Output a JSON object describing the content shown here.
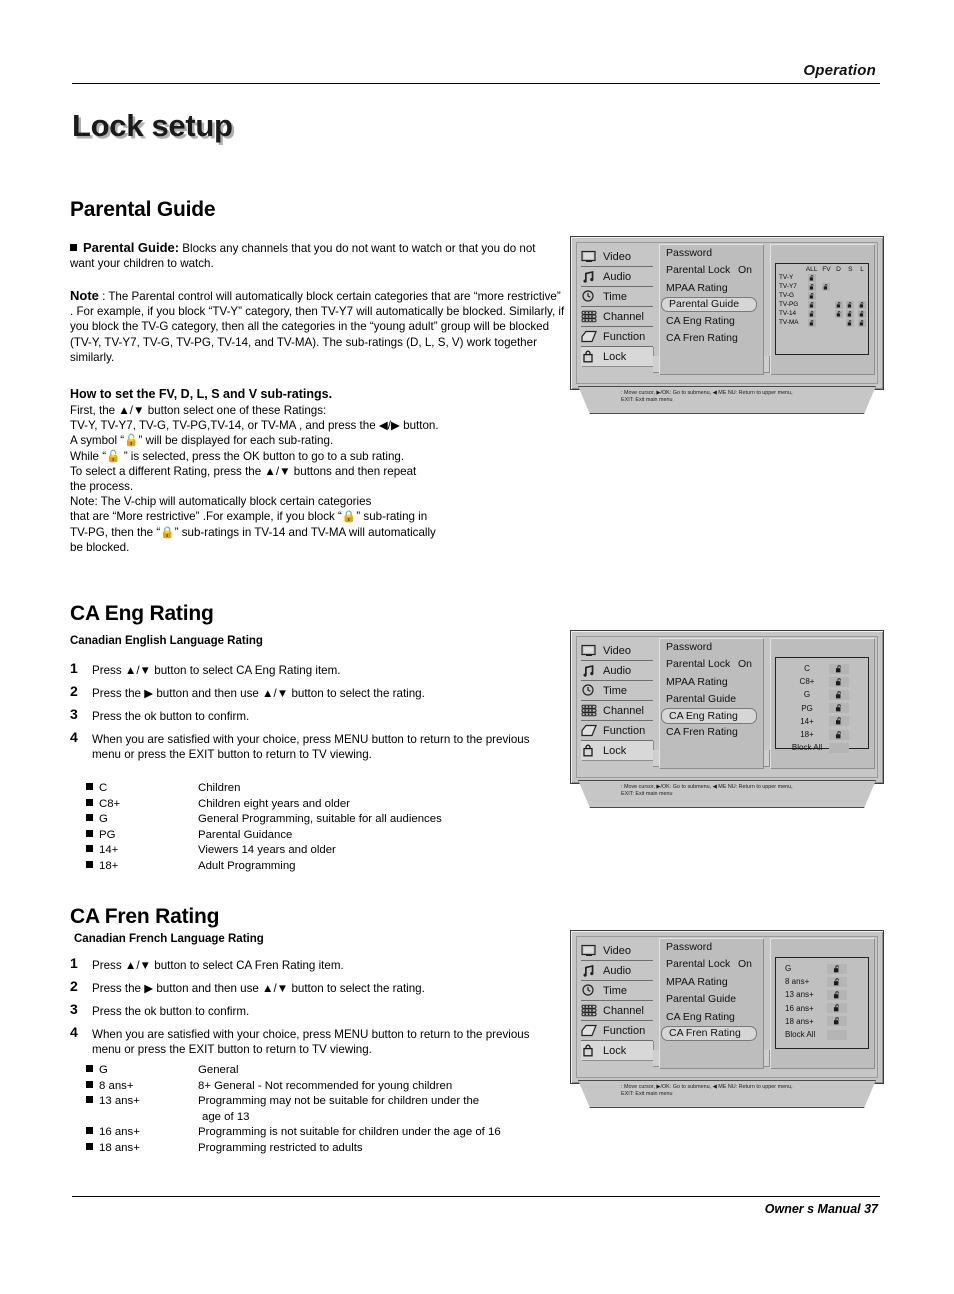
{
  "header": {
    "section_label": "Operation"
  },
  "footer": {
    "label": "Owner s Manual  37"
  },
  "page_title": "Lock setup",
  "sections": {
    "parental_guide": {
      "heading": "Parental Guide",
      "bullet_term": "Parental Guide:",
      "bullet_text": " Blocks any channels that you do not want to watch or that you do not want your children to watch.",
      "note_term": "Note",
      "note_text": " : The Parental control will automatically block certain categories that are  “more restrictive” . For example, if you block  “TV-Y”  category, then TV-Y7 will automatically be blocked. Similarly, if you block the TV-G category, then all the categories in the  “young adult”  group will be blocked (TV-Y, TV-Y7, TV-G, TV-PG, TV-14, and TV-MA). The sub-ratings (D, L, S, V) work together similarly.",
      "how_heading": "How to set the FV, D, L, S and V sub-ratings.",
      "how_lines": [
        "First, the ▲/▼ button select one of these Ratings:",
        "TV-Y, TV-Y7, TV-G, TV-PG,TV-14, or TV-MA , and press the ◀/▶ button.",
        "A symbol  “🔓”  will be displayed for each sub-rating.",
        "While “🔓 ”  is selected, press the OK button to go to a sub rating.",
        " To select a different Rating, press the ▲/▼ buttons and then repeat",
        "the process.",
        "Note: The V-chip will automatically block certain categories",
        "that are  “More restrictive”  .For example, if you block  “🔒”  sub-rating in",
        "TV-PG, then the  “🔒”  sub-ratings in TV-14 and TV-MA will automatically",
        "be blocked."
      ]
    },
    "ca_eng": {
      "heading": "CA Eng Rating",
      "subheading": "Canadian English Language Rating",
      "steps": [
        {
          "num": "1",
          "text": "Press ▲/▼ button to select CA Eng Rating item."
        },
        {
          "num": "2",
          "text": "Press the ▶ button and then use ▲/▼ button to select the rating."
        },
        {
          "num": "3",
          "text": "Press the ok button to confirm."
        },
        {
          "num": "4",
          "text": "When you are satisfied with your choice,  press MENU button to return to the previous menu or press the EXIT button to return to TV viewing."
        }
      ],
      "definitions": [
        {
          "term": "C",
          "desc": "Children"
        },
        {
          "term": "C8+",
          "desc": "Children eight years and older"
        },
        {
          "term": "G",
          "desc": "General Programming, suitable for all audiences"
        },
        {
          "term": "PG",
          "desc": "Parental Guidance"
        },
        {
          "term": "14+",
          "desc": "Viewers 14 years and older"
        },
        {
          "term": "18+",
          "desc": "Adult Programming"
        }
      ]
    },
    "ca_fren": {
      "heading": "CA Fren Rating",
      "subheading": "Canadian French Language Rating",
      "steps": [
        {
          "num": "1",
          "text": "Press ▲/▼ button to select CA Fren Rating item."
        },
        {
          "num": "2",
          "text": "Press the ▶ button and then use ▲/▼ button to select the rating."
        },
        {
          "num": "3",
          "text": "Press the ok button to confirm."
        },
        {
          "num": "4",
          "text": "When you are satisfied with your choice,  press MENU button to return to the previous menu or press the EXIT button to return to TV viewing."
        }
      ],
      "definitions": [
        {
          "term": "G",
          "desc": "General"
        },
        {
          "term": "8 ans+",
          "desc": "8+ General - Not recommended for young children"
        },
        {
          "term": "13 ans+",
          "desc": "Programming may not be suitable for children under the"
        },
        {
          "term": "",
          "desc": "age of 13"
        },
        {
          "term": "16 ans+",
          "desc": "Programming is not suitable for children under the age of 16"
        },
        {
          "term": "18 ans+",
          "desc": "Programming restricted to adults"
        }
      ]
    }
  },
  "osd": {
    "nav_items": [
      {
        "label": "Video",
        "icon": "monitor-icon"
      },
      {
        "label": "Audio",
        "icon": "music-note-icon"
      },
      {
        "label": "Time",
        "icon": "clock-icon"
      },
      {
        "label": "Channel",
        "icon": "channel-bars-icon"
      },
      {
        "label": "Function",
        "icon": "tag-icon"
      },
      {
        "label": "Lock",
        "icon": "padlock-icon"
      }
    ],
    "menu_items": [
      {
        "label": "Password",
        "value": ""
      },
      {
        "label": "Parental Lock",
        "value": "On"
      },
      {
        "label": "MPAA Rating",
        "value": ""
      },
      {
        "label": "Parental Guide",
        "value": ""
      },
      {
        "label": "CA Eng Rating",
        "value": ""
      },
      {
        "label": "CA Fren Rating",
        "value": ""
      }
    ],
    "hint": ": Move cursor,  ▶/OK: Go to submenu,  ◀ ME NU: Return to upper menu,\nEXIT: Exit main menu",
    "panel1": {
      "selected_menu": "Parental Guide",
      "grid": {
        "columns": [
          "ALL",
          "FV",
          "D",
          "S",
          "L"
        ],
        "rows": [
          {
            "name": "TV-Y",
            "cells": [
              true,
              false,
              false,
              false,
              false
            ]
          },
          {
            "name": "TV-Y7",
            "cells": [
              true,
              true,
              false,
              false,
              false
            ]
          },
          {
            "name": "TV-G",
            "cells": [
              true,
              false,
              false,
              false,
              false
            ]
          },
          {
            "name": "TV-PG",
            "cells": [
              true,
              false,
              true,
              true,
              true
            ]
          },
          {
            "name": "TV-14",
            "cells": [
              true,
              false,
              true,
              true,
              true
            ]
          },
          {
            "name": "TV-MA",
            "cells": [
              true,
              false,
              false,
              true,
              true
            ]
          }
        ]
      }
    },
    "panel2": {
      "selected_menu": "CA Eng Rating",
      "list": [
        {
          "name": "C",
          "lock": true
        },
        {
          "name": "C8+",
          "lock": true
        },
        {
          "name": "G",
          "lock": true
        },
        {
          "name": "PG",
          "lock": true
        },
        {
          "name": "14+",
          "lock": true
        },
        {
          "name": "18+",
          "lock": true
        },
        {
          "name": "Block All",
          "lock": false
        }
      ]
    },
    "panel3": {
      "selected_menu": "CA Fren Rating",
      "list": [
        {
          "name": "G",
          "lock": true
        },
        {
          "name": "8 ans+",
          "lock": true
        },
        {
          "name": "13 ans+",
          "lock": true
        },
        {
          "name": "16 ans+",
          "lock": true
        },
        {
          "name": "18 ans+",
          "lock": true
        },
        {
          "name": "Block All",
          "lock": false
        }
      ]
    }
  },
  "colors": {
    "osd_bg": "#c6c6c6",
    "osd_panel": "#bdbdbd",
    "highlight": "#d6d6d6",
    "ink": "#000000"
  }
}
